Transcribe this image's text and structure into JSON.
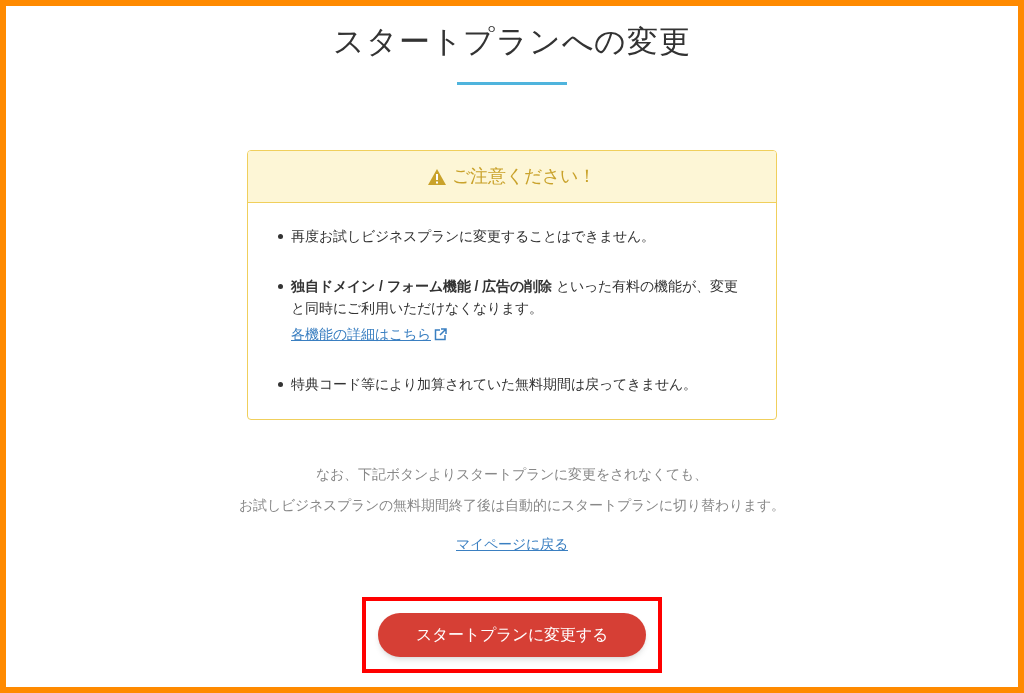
{
  "title": "スタートプランへの変更",
  "notice": {
    "heading": "ご注意ください！",
    "items": [
      {
        "text": "再度お試しビジネスプランに変更することはできません。"
      },
      {
        "text": "**独自ドメイン / フォーム機能 / 広告の削除** といった有料の機能が、変更と同時にご利用いただけなくなります。",
        "link": "各機能の詳細はこちら"
      },
      {
        "text": "特典コード等により加算されていた無料期間は戻ってきません。"
      }
    ]
  },
  "note": [
    "なお、下記ボタンよりスタートプランに変更をされなくても、",
    "お試しビジネスプランの無料期間終了後は自動的にスタートプランに切り替わります。"
  ],
  "back_link": "マイページに戻る",
  "submit_button": {
    "label": "スタートプランに変更する",
    "highlighted": true
  }
}
